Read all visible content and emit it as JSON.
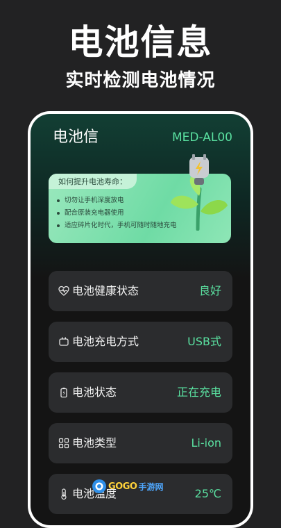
{
  "promo": {
    "title": "电池信息",
    "subtitle": "实时检测电池情况"
  },
  "app": {
    "title": "电池信",
    "device_model": "MED-AL00"
  },
  "tips": {
    "title": "如何提升电池寿命：",
    "items": [
      "切勿让手机深度放电",
      "配合原装充电器使用",
      "适应碎片化时代，手机可随时随地充电"
    ]
  },
  "rows": [
    {
      "icon": "heart-pulse-icon",
      "label": "电池健康状态",
      "value": "良好"
    },
    {
      "icon": "charger-icon",
      "label": "电池充电方式",
      "value": "USB式"
    },
    {
      "icon": "battery-icon",
      "label": "电池状态",
      "value": "正在充电"
    },
    {
      "icon": "grid-icon",
      "label": "电池类型",
      "value": "Li-ion"
    },
    {
      "icon": "thermometer-icon",
      "label": "电池温度",
      "value": "25℃"
    }
  ],
  "watermark": {
    "brand": "GOGO",
    "text": "手游网"
  },
  "colors": {
    "background": "#222223",
    "accent": "#5ae0a0",
    "card": "#2b2c2e",
    "tips_card": "#7fe0ad"
  }
}
